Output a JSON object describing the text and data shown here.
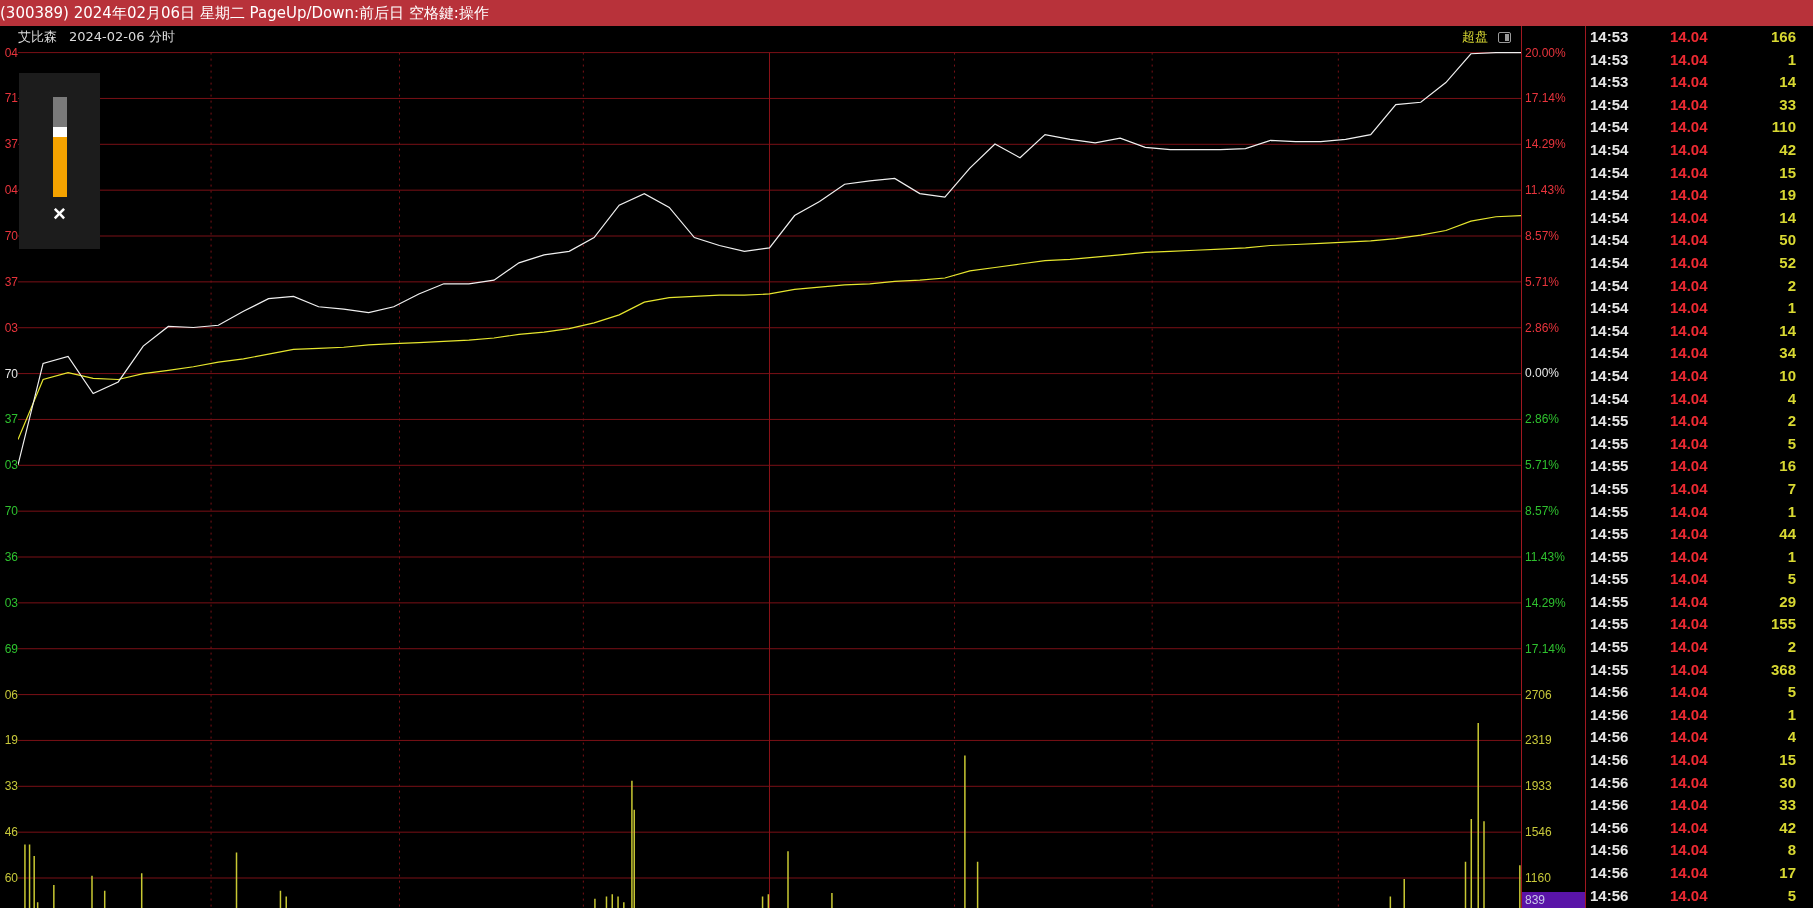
{
  "title_bar": {
    "text": "(300389) 2024年02月06日 星期二 PageUp/Down:前后日 空格鍵:操作"
  },
  "chart": {
    "stock_name": "艾比森",
    "date_mode": "2024-02-06 分时",
    "toggle_label": "超盘",
    "left_axis": [
      {
        "label": "04",
        "kind": "up"
      },
      {
        "label": "71",
        "kind": "up"
      },
      {
        "label": "37",
        "kind": "up"
      },
      {
        "label": "04",
        "kind": "up"
      },
      {
        "label": "70",
        "kind": "up"
      },
      {
        "label": "37",
        "kind": "up"
      },
      {
        "label": "03",
        "kind": "up"
      },
      {
        "label": "70",
        "kind": "flat"
      },
      {
        "label": "37",
        "kind": "down"
      },
      {
        "label": "03",
        "kind": "down"
      },
      {
        "label": "70",
        "kind": "down"
      },
      {
        "label": "36",
        "kind": "down"
      },
      {
        "label": "03",
        "kind": "down"
      },
      {
        "label": "69",
        "kind": "down"
      },
      {
        "label": "06",
        "kind": "volume"
      },
      {
        "label": "19",
        "kind": "volume"
      },
      {
        "label": "33",
        "kind": "volume"
      },
      {
        "label": "46",
        "kind": "volume"
      },
      {
        "label": "60",
        "kind": "volume"
      }
    ],
    "right_axis": [
      {
        "label": "2.86%",
        "kind": "down"
      },
      {
        "label": "5.71%",
        "kind": "down"
      },
      {
        "label": "8.57%",
        "kind": "down"
      },
      {
        "label": "11.43%",
        "kind": "down"
      },
      {
        "label": "14.29%",
        "kind": "down"
      },
      {
        "label": "17.14%",
        "kind": "down"
      },
      {
        "label": "2706",
        "kind": "volume"
      },
      {
        "label": "2319",
        "kind": "volume"
      },
      {
        "label": "1933",
        "kind": "volume"
      },
      {
        "label": "1546",
        "kind": "volume"
      },
      {
        "label": "1160",
        "kind": "volume"
      }
    ],
    "cursor_value": "839",
    "chart_data": {
      "type": "line",
      "ylim": [
        -33.33,
        20
      ],
      "grid": true,
      "yticks": [
        {
          "value": 20,
          "label": "20.00%"
        },
        {
          "value": 17.14,
          "label": "17.14%"
        },
        {
          "value": 14.29,
          "label": "14.29%"
        },
        {
          "value": 11.43,
          "label": "11.43%"
        },
        {
          "value": 8.57,
          "label": "8.57%"
        },
        {
          "value": 5.71,
          "label": "5.71%"
        },
        {
          "value": 2.86,
          "label": "2.86%"
        },
        {
          "value": 0,
          "label": "0.00%"
        }
      ],
      "categories": [
        null,
        null,
        null,
        null,
        null,
        null,
        null,
        null,
        null,
        null,
        null,
        null,
        null,
        null,
        null,
        null,
        null,
        null,
        null,
        null,
        null,
        null,
        null,
        null,
        null,
        null,
        null,
        null,
        null,
        null,
        null,
        null,
        null,
        null,
        null,
        null,
        null,
        null,
        null,
        null,
        null,
        null,
        null,
        null,
        null,
        null,
        null,
        null,
        null,
        null,
        null,
        null,
        null,
        null,
        null,
        null,
        null,
        null,
        null,
        null,
        null
      ],
      "series": [
        {
          "color": "#f0f0f0",
          "values": [
            -5.71,
            0.62,
            1.06,
            -1.25,
            -0.53,
            1.7,
            2.93,
            2.86,
            3.0,
            3.87,
            4.66,
            4.8,
            4.15,
            4.01,
            3.79,
            4.15,
            4.95,
            5.59,
            5.59,
            5.81,
            6.89,
            7.39,
            7.61,
            8.47,
            10.49,
            11.21,
            10.35,
            8.47,
            7.97,
            7.61,
            7.83,
            9.84,
            10.71,
            11.79,
            12.0,
            12.15,
            11.21,
            10.99,
            12.79,
            14.3,
            13.44,
            14.88,
            14.59,
            14.37,
            14.67,
            14.09,
            13.95,
            13.95,
            13.95,
            14.02,
            14.52,
            14.45,
            14.45,
            14.59,
            14.88,
            16.76,
            16.9,
            18.13,
            19.93,
            20.0,
            20.0
          ]
        },
        {
          "color": "#e6e62e",
          "values": [
            -4.13,
            -0.38,
            0.05,
            -0.31,
            -0.38,
            -0.02,
            0.19,
            0.41,
            0.7,
            0.91,
            1.2,
            1.49,
            1.56,
            1.63,
            1.78,
            1.85,
            1.92,
            1.99,
            2.07,
            2.21,
            2.43,
            2.57,
            2.79,
            3.15,
            3.65,
            4.44,
            4.73,
            4.8,
            4.87,
            4.87,
            4.95,
            5.24,
            5.38,
            5.52,
            5.59,
            5.74,
            5.81,
            5.95,
            6.39,
            6.6,
            6.82,
            7.03,
            7.11,
            7.25,
            7.39,
            7.54,
            7.61,
            7.68,
            7.75,
            7.83,
            7.97,
            8.04,
            8.11,
            8.19,
            8.26,
            8.4,
            8.62,
            8.91,
            9.49,
            9.77,
            9.84
          ]
        }
      ]
    }
  },
  "gauge": {
    "level": 0.7,
    "close": "×"
  },
  "trades": [
    {
      "time": "14:53",
      "price": "14.04",
      "volume": "166"
    },
    {
      "time": "14:53",
      "price": "14.04",
      "volume": "1"
    },
    {
      "time": "14:53",
      "price": "14.04",
      "volume": "14"
    },
    {
      "time": "14:54",
      "price": "14.04",
      "volume": "33"
    },
    {
      "time": "14:54",
      "price": "14.04",
      "volume": "110"
    },
    {
      "time": "14:54",
      "price": "14.04",
      "volume": "42"
    },
    {
      "time": "14:54",
      "price": "14.04",
      "volume": "15"
    },
    {
      "time": "14:54",
      "price": "14.04",
      "volume": "19"
    },
    {
      "time": "14:54",
      "price": "14.04",
      "volume": "14"
    },
    {
      "time": "14:54",
      "price": "14.04",
      "volume": "50"
    },
    {
      "time": "14:54",
      "price": "14.04",
      "volume": "52"
    },
    {
      "time": "14:54",
      "price": "14.04",
      "volume": "2"
    },
    {
      "time": "14:54",
      "price": "14.04",
      "volume": "1"
    },
    {
      "time": "14:54",
      "price": "14.04",
      "volume": "14"
    },
    {
      "time": "14:54",
      "price": "14.04",
      "volume": "34"
    },
    {
      "time": "14:54",
      "price": "14.04",
      "volume": "10"
    },
    {
      "time": "14:54",
      "price": "14.04",
      "volume": "4"
    },
    {
      "time": "14:55",
      "price": "14.04",
      "volume": "2"
    },
    {
      "time": "14:55",
      "price": "14.04",
      "volume": "5"
    },
    {
      "time": "14:55",
      "price": "14.04",
      "volume": "16"
    },
    {
      "time": "14:55",
      "price": "14.04",
      "volume": "7"
    },
    {
      "time": "14:55",
      "price": "14.04",
      "volume": "1"
    },
    {
      "time": "14:55",
      "price": "14.04",
      "volume": "44"
    },
    {
      "time": "14:55",
      "price": "14.04",
      "volume": "1"
    },
    {
      "time": "14:55",
      "price": "14.04",
      "volume": "5"
    },
    {
      "time": "14:55",
      "price": "14.04",
      "volume": "29"
    },
    {
      "time": "14:55",
      "price": "14.04",
      "volume": "155"
    },
    {
      "time": "14:55",
      "price": "14.04",
      "volume": "2"
    },
    {
      "time": "14:55",
      "price": "14.04",
      "volume": "368"
    },
    {
      "time": "14:56",
      "price": "14.04",
      "volume": "5"
    },
    {
      "time": "14:56",
      "price": "14.04",
      "volume": "1"
    },
    {
      "time": "14:56",
      "price": "14.04",
      "volume": "4"
    },
    {
      "time": "14:56",
      "price": "14.04",
      "volume": "15"
    },
    {
      "time": "14:56",
      "price": "14.04",
      "volume": "30"
    },
    {
      "time": "14:56",
      "price": "14.04",
      "volume": "33"
    },
    {
      "time": "14:56",
      "price": "14.04",
      "volume": "42"
    },
    {
      "time": "14:56",
      "price": "14.04",
      "volume": "8"
    },
    {
      "time": "14:56",
      "price": "14.04",
      "volume": "17"
    },
    {
      "time": "14:56",
      "price": "14.04",
      "volume": "5"
    }
  ]
}
